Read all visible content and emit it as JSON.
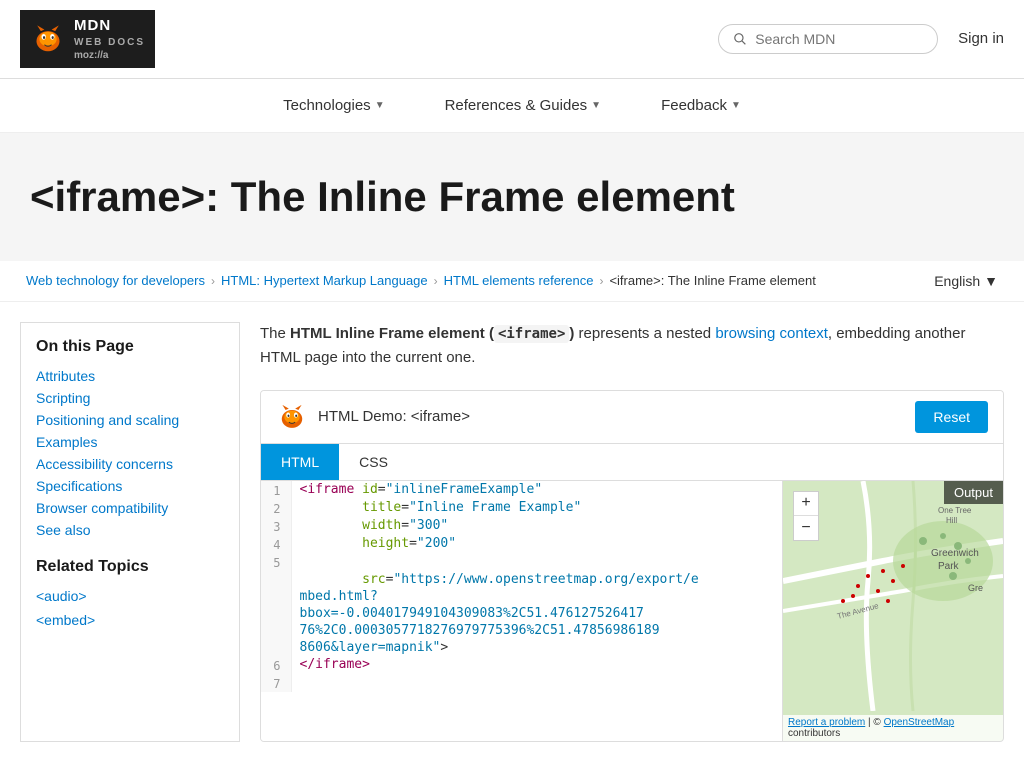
{
  "header": {
    "logo_alt": "MDN Web Docs",
    "mdn_text": "MDN",
    "webdocs_text": "web docs",
    "mozilla_text": "moz://a",
    "search_placeholder": "Search MDN",
    "sign_in": "Sign in"
  },
  "nav": {
    "technologies": "Technologies",
    "references_guides": "References & Guides",
    "feedback": "Feedback"
  },
  "hero": {
    "title": "<iframe>: The Inline Frame element"
  },
  "breadcrumb": {
    "web_tech": "Web technology for developers",
    "html": "HTML: Hypertext Markup Language",
    "elements_ref": "HTML elements reference",
    "current": "<iframe>: The Inline Frame element",
    "language": "English"
  },
  "sidebar": {
    "on_this_page": "On this Page",
    "items": [
      {
        "label": "Attributes"
      },
      {
        "label": "Scripting"
      },
      {
        "label": "Positioning and scaling"
      },
      {
        "label": "Examples"
      },
      {
        "label": "Accessibility concerns"
      },
      {
        "label": "Specifications"
      },
      {
        "label": "Browser compatibility"
      },
      {
        "label": "See also"
      }
    ],
    "related_topics": "Related Topics",
    "related_items": [
      {
        "label": "<audio>"
      },
      {
        "label": "<embed>"
      }
    ]
  },
  "content": {
    "intro_bold": "HTML Inline Frame element (",
    "intro_code": "<iframe>",
    "intro_mid": ") represents a nested ",
    "intro_link": "browsing context",
    "intro_end": ", embedding another HTML page into the current one."
  },
  "demo": {
    "title": "HTML Demo: <iframe>",
    "reset_btn": "Reset",
    "tabs": [
      "HTML",
      "CSS"
    ],
    "active_tab": "HTML",
    "output_label": "Output",
    "code_lines": [
      {
        "num": "1",
        "content": "<iframe id=\"inlineFrameExample\""
      },
      {
        "num": "2",
        "content": "        title=\"Inline Frame Example\""
      },
      {
        "num": "3",
        "content": "        width=\"300\""
      },
      {
        "num": "4",
        "content": "        height=\"200\""
      },
      {
        "num": "5",
        "content": ""
      },
      {
        "num": "",
        "content": "        src=\"https://www.openstreetmap.org/export/e"
      },
      {
        "num": "",
        "content": "mbed.html?"
      },
      {
        "num": "",
        "content": "bbox=-0.004017949104309083%2C51.476127526417"
      },
      {
        "num": "",
        "content": "76%2C0.0003057718276979775396%2C51.478569861898606&layer=mapnik\">"
      },
      {
        "num": "6",
        "content": "</iframe>"
      },
      {
        "num": "7",
        "content": ""
      }
    ],
    "map": {
      "plus": "+",
      "minus": "−",
      "report_problem": "Report a problem",
      "attribution_sep": "| ©",
      "openstreetmap": "OpenStreetMap",
      "contributors": "contributors"
    }
  }
}
